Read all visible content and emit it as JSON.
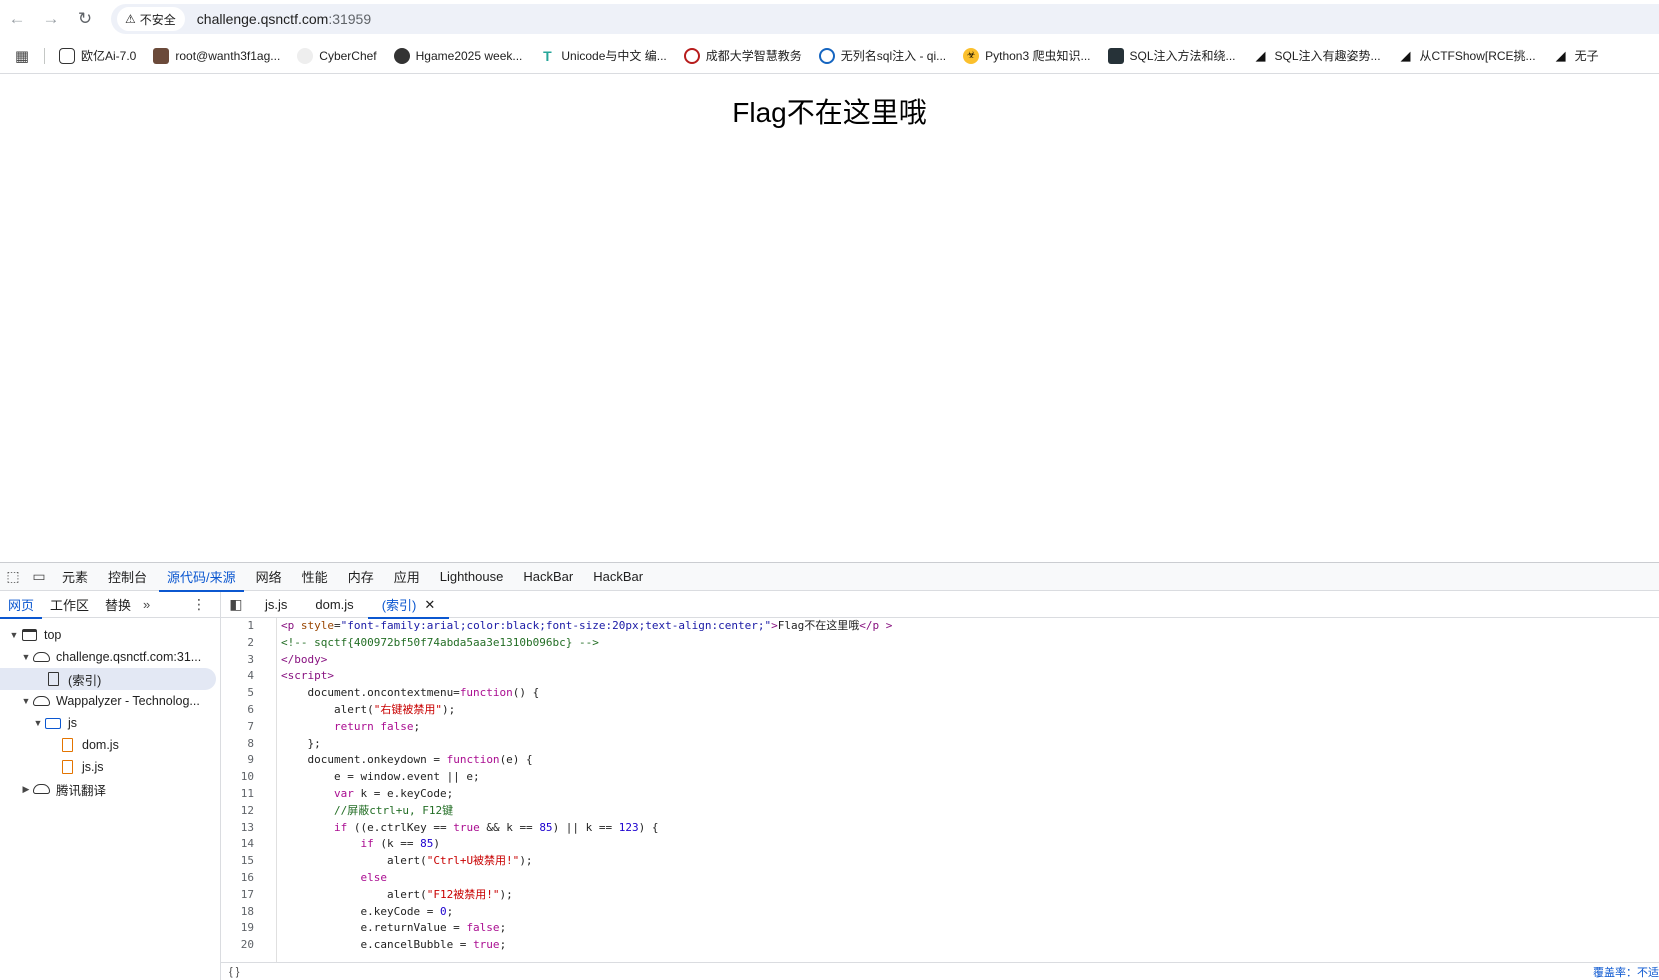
{
  "browser": {
    "security_label": "不安全",
    "url_host": "challenge.qsnctf.com",
    "url_port": ":31959",
    "bookmarks": [
      {
        "label": "欧亿Ai-7.0",
        "icon": "chat-icon"
      },
      {
        "label": "root@wanth3f1ag...",
        "icon": "avatar-icon"
      },
      {
        "label": "CyberChef",
        "icon": "chef-hat-icon"
      },
      {
        "label": "Hgame2025 week...",
        "icon": "avatar-icon"
      },
      {
        "label": "Unicode与中文 编...",
        "icon": "t-icon"
      },
      {
        "label": "成都大学智慧教务",
        "icon": "seal-icon"
      },
      {
        "label": "无列名sql注入 - qi...",
        "icon": "circle-icon"
      },
      {
        "label": "Python3 爬虫知识...",
        "icon": "biohazard-icon"
      },
      {
        "label": "SQL注入方法和绕...",
        "icon": "image-icon"
      },
      {
        "label": "SQL注入有趣姿势...",
        "icon": "slash-icon"
      },
      {
        "label": "从CTFShow[RCE挑...",
        "icon": "slash-icon"
      },
      {
        "label": "无子",
        "icon": "slash-icon"
      }
    ]
  },
  "page": {
    "heading": "Flag不在这里哦"
  },
  "devtools": {
    "tabs": [
      "元素",
      "控制台",
      "源代码/来源",
      "网络",
      "性能",
      "内存",
      "应用",
      "Lighthouse",
      "HackBar",
      "HackBar"
    ],
    "active_tab": "源代码/来源",
    "nav_tabs": [
      "网页",
      "工作区",
      "替换"
    ],
    "tree": {
      "top": "top",
      "host": "challenge.qsnctf.com:31...",
      "index": "(索引)",
      "ext": "Wappalyzer - Technolog...",
      "folder": "js",
      "file1": "dom.js",
      "file2": "js.js",
      "translate": "腾讯翻译"
    },
    "file_tabs": [
      "js.js",
      "dom.js",
      "(索引)"
    ],
    "active_file": "(索引)",
    "status_right": "覆盖率：不适"
  }
}
